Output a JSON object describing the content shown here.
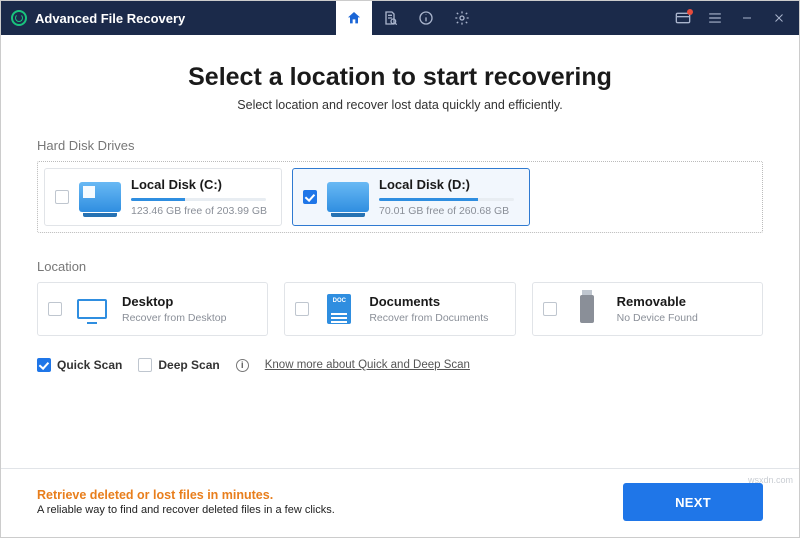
{
  "app": {
    "title": "Advanced File Recovery"
  },
  "main": {
    "heading": "Select a location to start recovering",
    "subheading": "Select location and recover lost data quickly and efficiently."
  },
  "sections": {
    "drives_label": "Hard Disk Drives",
    "location_label": "Location"
  },
  "drives": [
    {
      "name": "Local Disk (C:)",
      "info": "123.46 GB free of 203.99 GB",
      "selected": false,
      "fill_pct": 40
    },
    {
      "name": "Local Disk (D:)",
      "info": "70.01 GB free of 260.68 GB",
      "selected": true,
      "fill_pct": 73
    }
  ],
  "locations": [
    {
      "name": "Desktop",
      "info": "Recover from Desktop"
    },
    {
      "name": "Documents",
      "info": "Recover from Documents"
    },
    {
      "name": "Removable",
      "info": "No Device Found"
    }
  ],
  "scan": {
    "quick_label": "Quick Scan",
    "deep_label": "Deep Scan",
    "link": "Know more about Quick and Deep Scan"
  },
  "footer": {
    "tip_title": "Retrieve deleted or lost files in minutes.",
    "tip_sub": "A reliable way to find and recover deleted files in a few clicks.",
    "next": "NEXT"
  },
  "watermark": "wsxdn.com"
}
